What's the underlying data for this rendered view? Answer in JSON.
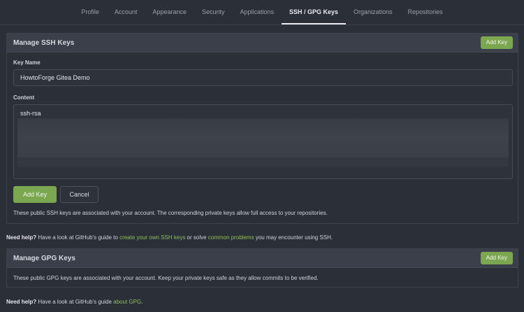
{
  "tabs": [
    "Profile",
    "Account",
    "Appearance",
    "Security",
    "Applications",
    "SSH / GPG Keys",
    "Organizations",
    "Repositories"
  ],
  "active_tab": "SSH / GPG Keys",
  "ssh": {
    "title": "Manage SSH Keys",
    "add_key_label": "Add Key",
    "key_name_label": "Key Name",
    "key_name_value": "HowtoForge Gitea Demo",
    "content_label": "Content",
    "content_value": "ssh-rsa",
    "submit_label": "Add Key",
    "cancel_label": "Cancel",
    "note": "These public SSH keys are associated with your account. The corresponding private keys allow full access to your repositories."
  },
  "ssh_help": {
    "strong": "Need help?",
    "pre": " Have a look at GitHub's guide to ",
    "link1": "create your own SSH keys",
    "mid": " or solve ",
    "link2": "common problems",
    "post": " you may encounter using SSH."
  },
  "gpg": {
    "title": "Manage GPG Keys",
    "add_key_label": "Add Key",
    "note": "These public GPG keys are associated with your account. Keep your private keys safe as they allow commits to be verified."
  },
  "gpg_help": {
    "strong": "Need help?",
    "pre": " Have a look at GitHub's guide ",
    "link": "about GPG",
    "post": "."
  },
  "colors": {
    "accent": "#7aa74f",
    "link": "#8fbf58",
    "background": "#2b2f38",
    "panel_header": "#3a3f4a"
  }
}
